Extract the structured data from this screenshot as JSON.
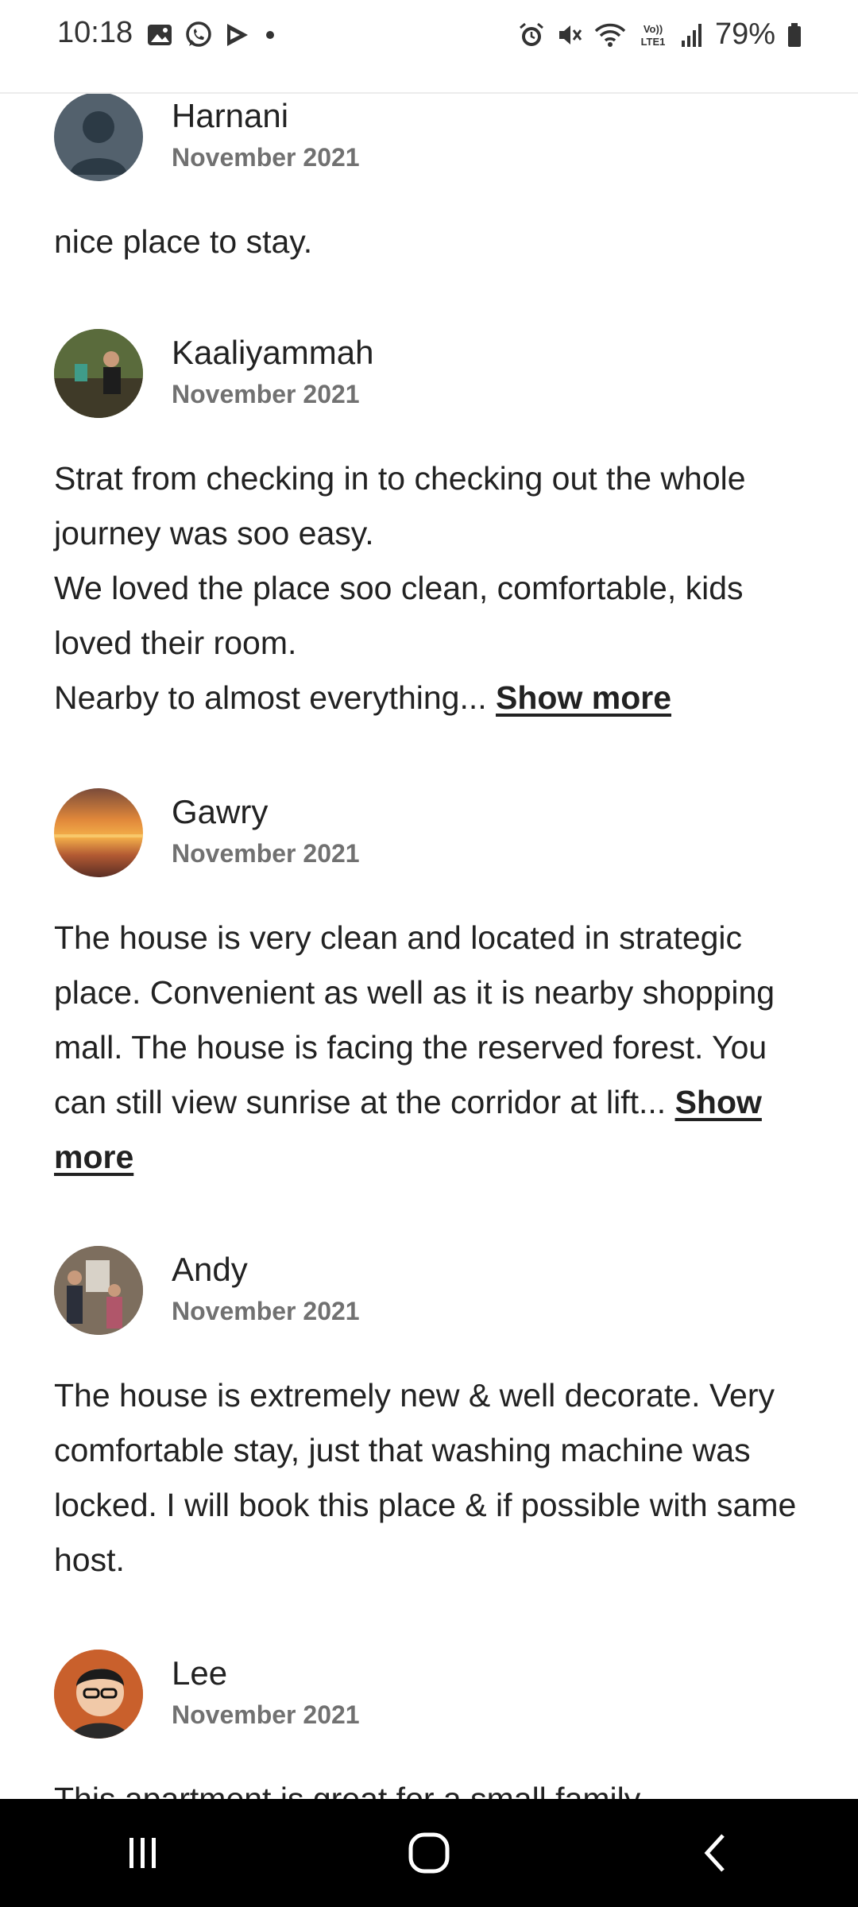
{
  "status_bar": {
    "time": "10:18",
    "battery": "79%",
    "icons_left": [
      "gallery-icon",
      "whatsapp-icon",
      "play-icon",
      "dot-icon"
    ],
    "icons_right": [
      "alarm-icon",
      "mute-icon",
      "wifi-icon",
      "volte-icon",
      "signal-icon",
      "battery-icon"
    ],
    "volte_label": "Vo)) LTE1"
  },
  "reviews": [
    {
      "name": "Harnani",
      "date": "November 2021",
      "text": "nice place to stay.",
      "avatar": "default-avatar"
    },
    {
      "name": "Kaaliyammah",
      "date": "November 2021",
      "text": "Strat from checking in to checking out the whole journey was soo easy.\nWe loved the place soo clean, comfortable, kids loved their room.\nNearby to almost everything... ",
      "show_more": "Show more",
      "avatar": "photo-avatar"
    },
    {
      "name": "Gawry",
      "date": "November 2021",
      "text": "The house is very clean and located in strategic place. Convenient as well as it is nearby shopping mall. The house is facing the reserved forest. You can still view sunrise at the corridor at lift... ",
      "show_more": "Show more",
      "avatar": "sunset-avatar"
    },
    {
      "name": "Andy",
      "date": "November 2021",
      "text": "The house is extremely new & well decorate. Very comfortable stay, just that washing machine was locked. I will book this place & if possible with same host.",
      "avatar": "photo-avatar"
    },
    {
      "name": "Lee",
      "date": "November 2021",
      "text": "This apartment is great for a small family",
      "avatar": "photo-avatar"
    }
  ],
  "nav_bar": {
    "buttons": [
      "recents-icon",
      "home-icon",
      "back-icon"
    ]
  },
  "colors": {
    "text": "#222222",
    "secondary_text": "#717171",
    "nav_background": "#000000"
  }
}
